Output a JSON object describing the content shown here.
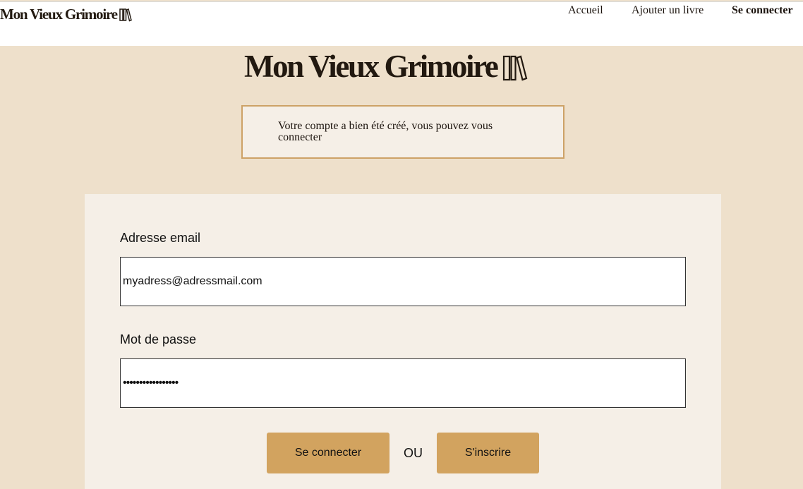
{
  "header": {
    "logo_text": "Mon Vieux Grimoire",
    "nav": {
      "home": "Accueil",
      "add_book": "Ajouter un livre",
      "login": "Se connecter"
    }
  },
  "hero": {
    "logo_text": "Mon Vieux Grimoire"
  },
  "notice": {
    "message": "Votre compte a bien été créé, vous pouvez vous connecter"
  },
  "form": {
    "email_label": "Adresse email",
    "email_value": "myadress@adressmail.com",
    "password_label": "Mot de passe",
    "password_value": "•••••••••••••••••",
    "login_button": "Se connecter",
    "or_text": "OU",
    "signup_button": "S'inscrire"
  },
  "colors": {
    "page_background": "#eee0cb",
    "card_background": "#f5efe7",
    "accent": "#d2a35f",
    "notice_border": "#cda267"
  },
  "icons": [
    "books-icon"
  ]
}
